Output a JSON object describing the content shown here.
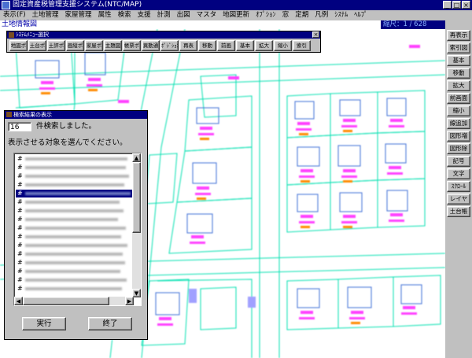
{
  "app": {
    "title": "固定資産税管理支援システム(NTC/MAP)"
  },
  "window_controls": {
    "minimize": "_",
    "maximize": "□",
    "close": "×"
  },
  "menu": [
    "表示(F)",
    "土地管理",
    "家屋管理",
    "属性",
    "検索",
    "支援",
    "計測",
    "出図",
    "マスタ",
    "地図更新",
    "ｵﾌﾟｼｮﾝ",
    "窓",
    "定期",
    "凡例",
    "ｼｽﾃﾑ",
    "ﾍﾙﾌﾟ"
  ],
  "infobar": {
    "label": "土地情報図",
    "scale": "縮尺：1 / 628"
  },
  "right_toolbar": [
    "再表示",
    "索引図",
    "基本",
    "移動",
    "拡大",
    "前画面",
    "縮小",
    "線追加",
    "図形増",
    "図形除",
    "記号",
    "文字",
    "ｽｸﾛｰﾙ",
    "レイヤ",
    "土台帳"
  ],
  "menu_panel": {
    "title": "ｼｽﾃﾑﾒﾆｭｰ選択",
    "close": "×",
    "buttons": [
      "地図ポ",
      "土台ポ",
      "土評ポ",
      "画縦ポ",
      "家屋ポ",
      "主題図",
      "帳票ポ",
      "異動通",
      "ﾎﾟｼﾞｼｮﾝ",
      "再表",
      "移動",
      "前画",
      "基本",
      "拡大",
      "縮小",
      "索引"
    ]
  },
  "search_result": {
    "title": "検索結果の表示",
    "count": "16",
    "count_label": "件検索しました。",
    "instruction": "表示させる対象を選んでください。",
    "rows": [
      "#",
      "#",
      "#",
      "#",
      "#",
      "#",
      "#",
      "#",
      "#",
      "#",
      "#",
      "#",
      "#",
      "#",
      "#",
      "#"
    ],
    "selected_index": 4,
    "execute_button": "実行",
    "end_button": "終了"
  },
  "colors": {
    "title_bar": "#000080",
    "map_line": "#00e0b0",
    "map_parcel_text": "#ff40ff",
    "map_lot_text": "#ff8a00"
  }
}
